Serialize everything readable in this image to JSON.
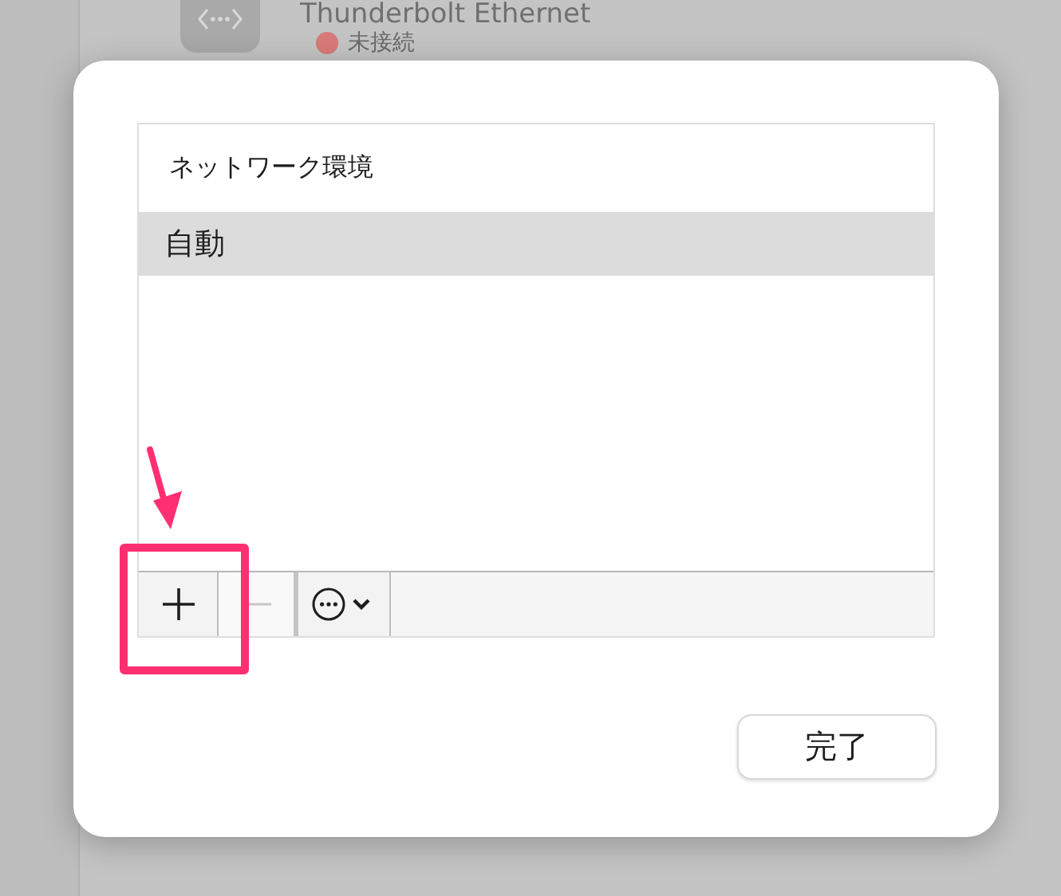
{
  "background": {
    "connection": {
      "name": "Thunderbolt Ethernet",
      "status": "未接続",
      "connected": false
    }
  },
  "dialog": {
    "list": {
      "header": "ネットワーク環境",
      "items": [
        {
          "label": "自動",
          "selected": true
        }
      ]
    },
    "toolbar": [
      {
        "kind": "add",
        "disabled": false
      },
      {
        "kind": "remove",
        "disabled": true
      },
      {
        "kind": "menu",
        "disabled": false
      }
    ],
    "done_button": "完了"
  }
}
